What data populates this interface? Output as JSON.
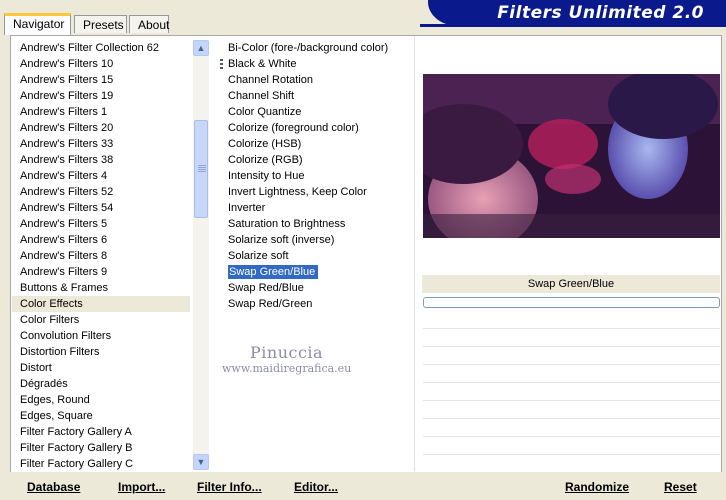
{
  "tabs": [
    "Navigator",
    "Presets",
    "About"
  ],
  "banner": {
    "title": "Filters Unlimited 2.0"
  },
  "categories": [
    "Andrew's Filter Collection 62",
    "Andrew's Filters 10",
    "Andrew's Filters 15",
    "Andrew's Filters 19",
    "Andrew's Filters 1",
    "Andrew's Filters 20",
    "Andrew's Filters 33",
    "Andrew's Filters 38",
    "Andrew's Filters 4",
    "Andrew's Filters 52",
    "Andrew's Filters 54",
    "Andrew's Filters 5",
    "Andrew's Filters 6",
    "Andrew's Filters 8",
    "Andrew's Filters 9",
    "Buttons & Frames",
    "Color Effects",
    "Color Filters",
    "Convolution Filters",
    "Distortion Filters",
    "Distort",
    "Dégradés",
    "Edges, Round",
    "Edges, Square",
    "Filter Factory Gallery A",
    "Filter Factory Gallery B",
    "Filter Factory Gallery C"
  ],
  "selected_category": "Color Effects",
  "filters": [
    "Bi-Color (fore-/background color)",
    "Black & White",
    "Channel Rotation",
    "Channel Shift",
    "Color Quantize",
    "Colorize (foreground color)",
    "Colorize (HSB)",
    "Colorize (RGB)",
    "Intensity to Hue",
    "Invert Lightness, Keep Color",
    "Inverter",
    "Saturation to Brightness",
    "Solarize soft (inverse)",
    "Solarize soft",
    "Swap Green/Blue",
    "Swap Red/Blue",
    "Swap Red/Green"
  ],
  "selected_filter": "Swap Green/Blue",
  "watermark": {
    "name": "Pinuccia",
    "site": "www.maidiregrafica.eu"
  },
  "current_filter_label": "Swap Green/Blue",
  "buttons": {
    "database": "Database",
    "import": "Import...",
    "filter_info": "Filter Info...",
    "editor": "Editor...",
    "randomize": "Randomize",
    "reset": "Reset"
  },
  "colors": {
    "banner": "#0a1a8c",
    "selection": "#316ac5",
    "face": "#ece9d8"
  },
  "icons": {
    "scroll_up": "chevron-up-icon",
    "scroll_down": "chevron-down-icon"
  }
}
